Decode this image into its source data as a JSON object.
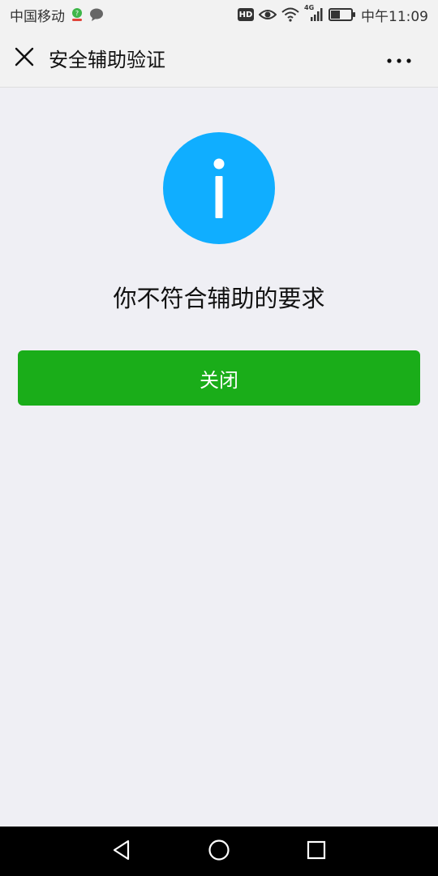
{
  "status_bar": {
    "carrier": "中国移动",
    "hd_label": "HD",
    "network_label": "4G",
    "time": "中午11:09",
    "battery_level": 0.45
  },
  "header": {
    "title": "安全辅助验证",
    "close_icon": "close-icon",
    "more_icon": "more-icon"
  },
  "main": {
    "icon": "info-icon",
    "icon_color": "#10aeff",
    "message": "你不符合辅助的要求",
    "close_button_label": "关闭",
    "button_color": "#1aad19"
  },
  "nav_bar": {
    "back_icon": "back-triangle-icon",
    "home_icon": "home-circle-icon",
    "recents_icon": "recents-square-icon"
  }
}
